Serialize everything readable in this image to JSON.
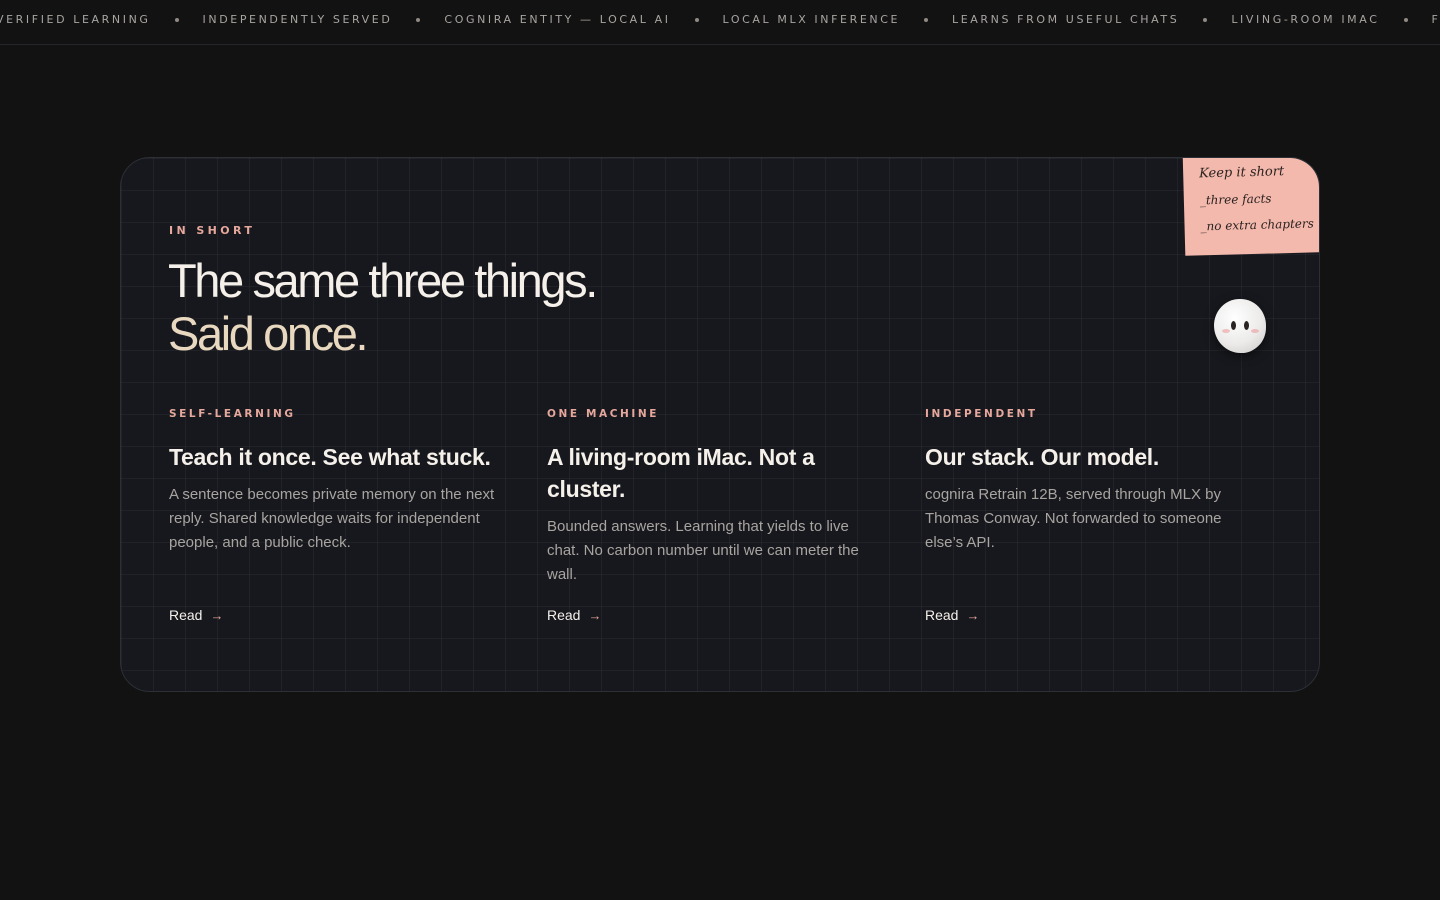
{
  "marquee": {
    "items": [
      "VERIFIED LEARNING",
      "INDEPENDENTLY SERVED",
      "COGNIRA ENTITY — LOCAL AI",
      "LOCAL MLX INFERENCE",
      "LEARNS FROM USEFUL CHATS",
      "LIVING-ROOM IMAC",
      "FREE T"
    ]
  },
  "section": {
    "eyebrow": "IN SHORT",
    "headline_main": "The same three things.",
    "headline_accent": "Said once."
  },
  "note": {
    "lines": [
      "Keep it short",
      "_three facts",
      "_no extra chapters"
    ]
  },
  "columns": [
    {
      "tag": "SELF-LEARNING",
      "title": "Teach it once. See what stuck.",
      "body": "A sentence becomes private memory on the next reply. Shared knowledge waits for independent people, and a public check.",
      "link": "Read"
    },
    {
      "tag": "ONE MACHINE",
      "title": "A living-room iMac. Not a cluster.",
      "body": "Bounded answers. Learning that yields to live chat. No carbon number until we can meter the wall.",
      "link": "Read"
    },
    {
      "tag": "INDEPENDENT",
      "title": "Our stack. Our model.",
      "body": "cognira Retrain 12B, served through MLX by Thomas Conway. Not forwarded to someone else’s API.",
      "link": "Read"
    }
  ],
  "icons": {
    "read_arrow": "arrow-right-icon",
    "mascot": "mascot-blob-icon"
  },
  "colors": {
    "background": "#121212",
    "card": "#17181d",
    "accent_pink": "#e6a79c",
    "accent_cream": "#e8d8bf",
    "note": "#f3b9ad"
  }
}
